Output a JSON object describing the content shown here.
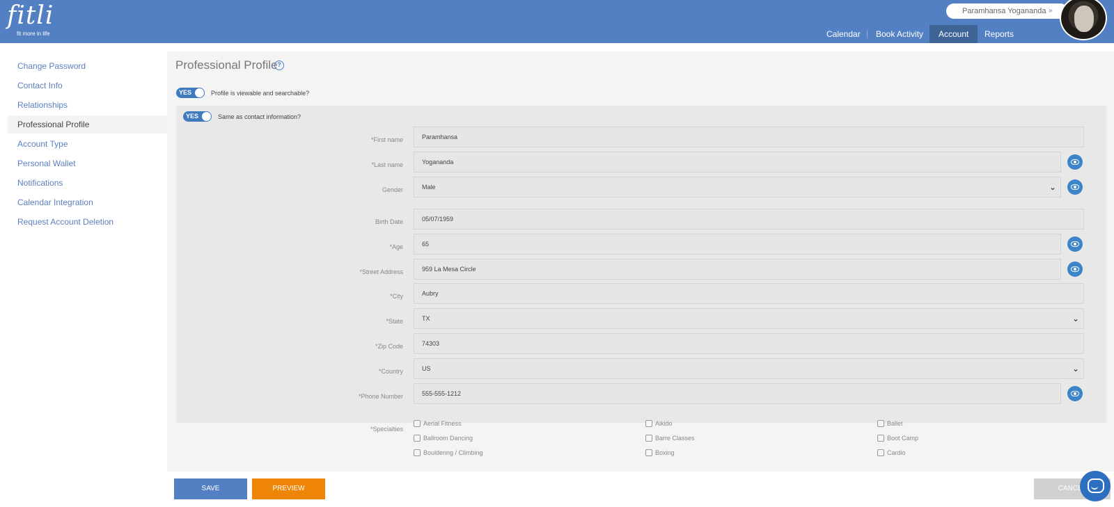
{
  "brand": {
    "logo_text": "fitli",
    "tagline": "fit more in life"
  },
  "user": {
    "name": "Paramhansa Yogananda",
    "chevron": "»"
  },
  "nav": [
    {
      "label": "Calendar"
    },
    {
      "label": "Book Activity"
    },
    {
      "label": "Account",
      "active": true
    },
    {
      "label": "Reports"
    }
  ],
  "sidebar": {
    "items": [
      {
        "label": "Change Password"
      },
      {
        "label": "Contact Info"
      },
      {
        "label": "Relationships"
      },
      {
        "label": "Professional Profile",
        "active": true
      },
      {
        "label": "Account Type"
      },
      {
        "label": "Personal Wallet"
      },
      {
        "label": "Notifications"
      },
      {
        "label": "Calendar Integration"
      },
      {
        "label": "Request Account Deletion"
      }
    ]
  },
  "main": {
    "title": "Professional Profile",
    "help_icon": "?",
    "toggle_searchable": {
      "state": "YES",
      "label": "Profile is viewable and searchable?"
    },
    "toggle_same": {
      "state": "YES",
      "label": "Same as contact information?"
    },
    "fields": [
      {
        "label": "*First name",
        "value": "Paramhansa"
      },
      {
        "label": "*Last name",
        "value": "Yogananda"
      },
      {
        "label": "Gender",
        "value": "Male"
      },
      {
        "label": "Birth Date",
        "value": "05/07/1959"
      },
      {
        "label": "*Age",
        "value": "65"
      },
      {
        "label": "*Street Address",
        "value": "959 La Mesa Circle"
      },
      {
        "label": "*City",
        "value": "Aubry"
      },
      {
        "label": "*State",
        "value": "TX"
      },
      {
        "label": "*Zip Code",
        "value": "74303"
      },
      {
        "label": "*Country",
        "value": "US"
      },
      {
        "label": "*Phone Number",
        "value": "555-555-1212"
      }
    ],
    "specialties_label": "*Specialties",
    "specialties": [
      "Aerial Fitness",
      "Aikido",
      "Ballet",
      "Ballroom Dancing",
      "Barre Classes",
      "Boot Camp",
      "Bouldering / Climbing",
      "Boxing",
      "Cardio"
    ]
  },
  "actions": {
    "save": "SAVE",
    "preview": "PREVIEW",
    "cancel": "CANCEL"
  },
  "colors": {
    "header": "#5380c2",
    "accent": "#3f79be",
    "preview": "#ef8506"
  }
}
